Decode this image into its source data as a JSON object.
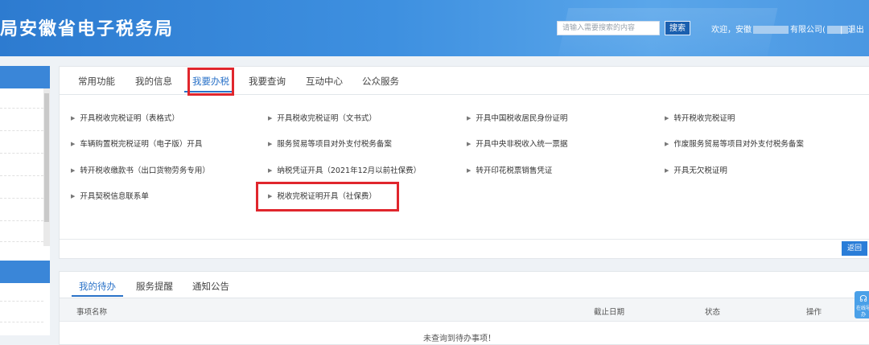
{
  "header": {
    "title": "局安徽省电子税务局",
    "search_placeholder": "请输入需要搜索的内容",
    "search_button": "搜索",
    "welcome_prefix": "欢迎，安徽",
    "company_suffix": "有限公司(",
    "company_close": ")",
    "separator": "|",
    "logout": "退出"
  },
  "main_tabs": [
    "常用功能",
    "我的信息",
    "我要办税",
    "我要查询",
    "互动中心",
    "公众服务"
  ],
  "functions": [
    "开具税收完税证明（表格式）",
    "开具税收完税证明（文书式）",
    "开具中国税收居民身份证明",
    "转开税收完税证明",
    "车辆购置税完税证明（电子版）开具",
    "服务贸易等项目对外支付税务备案",
    "开具中央非税收入统一票据",
    "作废服务贸易等项目对外支付税务备案",
    "转开税收缴款书（出口货物劳务专用）",
    "纳税凭证开具（2021年12月以前社保费）",
    "转开印花税票销售凭证",
    "开具无欠税证明",
    "开具契税信息联系单",
    "税收完税证明开具（社保费）"
  ],
  "back_button": "返回",
  "todo": {
    "tabs": [
      "我的待办",
      "服务提醒",
      "通知公告"
    ],
    "columns": [
      "事项名称",
      "截止日期",
      "状态",
      "操作"
    ],
    "empty_text": "未查询到待办事项！"
  },
  "float_button": {
    "icon": "headset-icon",
    "label": "在线导办"
  },
  "colors": {
    "header_blue": "#3e90e0",
    "accent_blue": "#2a72c8",
    "highlight_red": "#e0262d"
  }
}
